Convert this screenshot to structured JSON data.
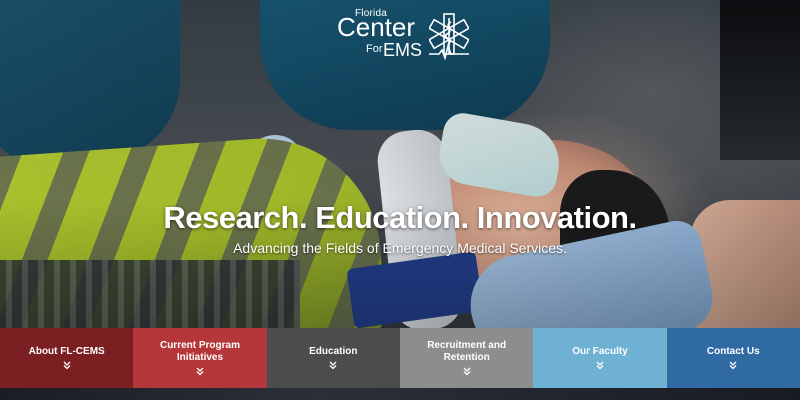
{
  "logo": {
    "line_small": "Florida",
    "line_big": "Center",
    "line_for": "For",
    "line_ems": "EMS"
  },
  "hero": {
    "headline": "Research. Education. Innovation.",
    "subheadline": "Advancing the Fields of Emergency Medical Services."
  },
  "nav": {
    "items": [
      {
        "label": "About FL-CEMS",
        "color": "#7b1f23",
        "icon": "double-chevron-down-icon"
      },
      {
        "label": "Current Program Initiatives",
        "color": "#b5373a",
        "icon": "double-chevron-down-icon"
      },
      {
        "label": "Education",
        "color": "#4b4c4e",
        "icon": "double-chevron-down-icon"
      },
      {
        "label": "Recruitment and Retention",
        "color": "#8c8d8f",
        "icon": "double-chevron-down-icon"
      },
      {
        "label": "Our Faculty",
        "color": "#6fb1d3",
        "icon": "double-chevron-down-icon"
      },
      {
        "label": "Contact Us",
        "color": "#2f6aa3",
        "icon": "double-chevron-down-icon"
      }
    ]
  }
}
